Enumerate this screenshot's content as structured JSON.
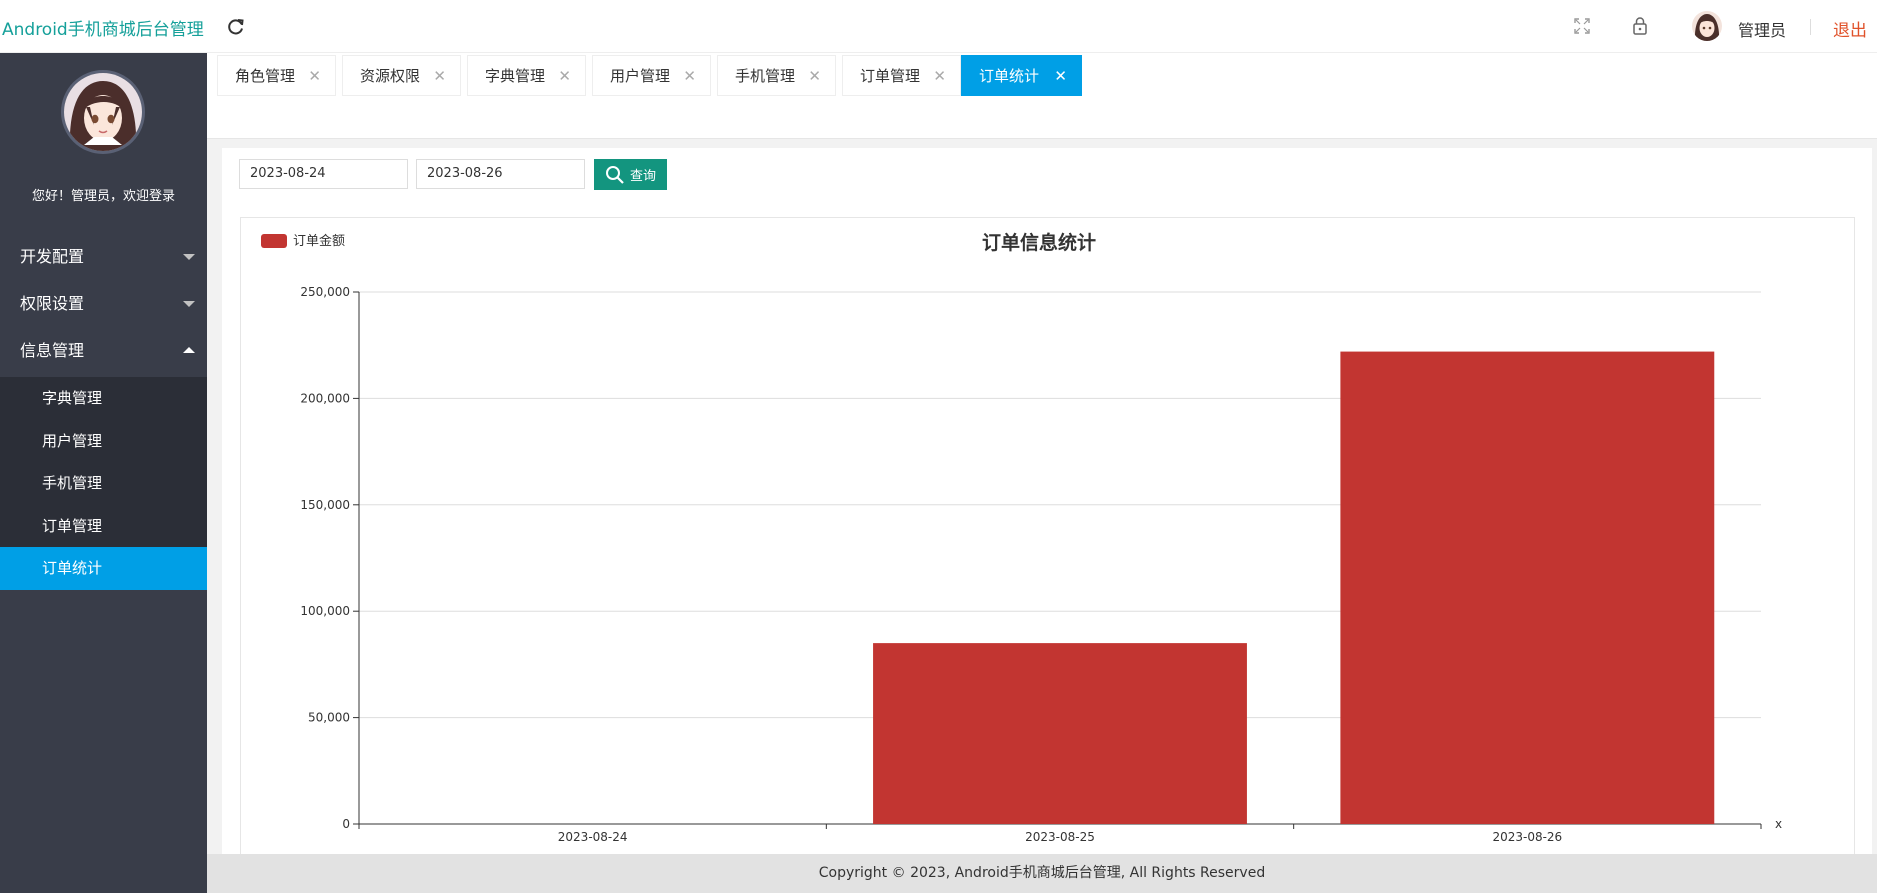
{
  "header": {
    "app_title": "Android手机商城后台管理",
    "user_name": "管理员",
    "logout_label": "退出"
  },
  "sidebar": {
    "welcome": "您好！管理员，欢迎登录",
    "groups": [
      {
        "label": "开发配置",
        "expanded": false
      },
      {
        "label": "权限设置",
        "expanded": false
      },
      {
        "label": "信息管理",
        "expanded": true
      }
    ],
    "subitems": [
      {
        "label": "字典管理",
        "active": false
      },
      {
        "label": "用户管理",
        "active": false
      },
      {
        "label": "手机管理",
        "active": false
      },
      {
        "label": "订单管理",
        "active": false
      },
      {
        "label": "订单统计",
        "active": true
      }
    ]
  },
  "tabs": [
    {
      "label": "角色管理",
      "active": false
    },
    {
      "label": "资源权限",
      "active": false
    },
    {
      "label": "字典管理",
      "active": false
    },
    {
      "label": "用户管理",
      "active": false
    },
    {
      "label": "手机管理",
      "active": false
    },
    {
      "label": "订单管理",
      "active": false
    },
    {
      "label": "订单统计",
      "active": true
    }
  ],
  "filters": {
    "start_date": "2023-08-24",
    "end_date": "2023-08-26",
    "query_label": "查询"
  },
  "chart_data": {
    "type": "bar",
    "title": "订单信息统计",
    "legend": [
      "订单金额"
    ],
    "legend_position": "top-left",
    "categories": [
      "2023-08-24",
      "2023-08-25",
      "2023-08-26"
    ],
    "series": [
      {
        "name": "订单金额",
        "values": [
          0,
          85000,
          222000
        ],
        "color": "#c23531"
      }
    ],
    "ylim": [
      0,
      250000
    ],
    "yticks": [
      0,
      50000,
      100000,
      150000,
      200000,
      250000
    ],
    "ytick_labels": [
      "0",
      "50,000",
      "100,000",
      "150,000",
      "200,000",
      "250,000"
    ],
    "xlabel": "x",
    "grid": true
  },
  "footer": {
    "copyright": "Copyright © 2023, Android手机商城后台管理, All Rights Reserved"
  }
}
